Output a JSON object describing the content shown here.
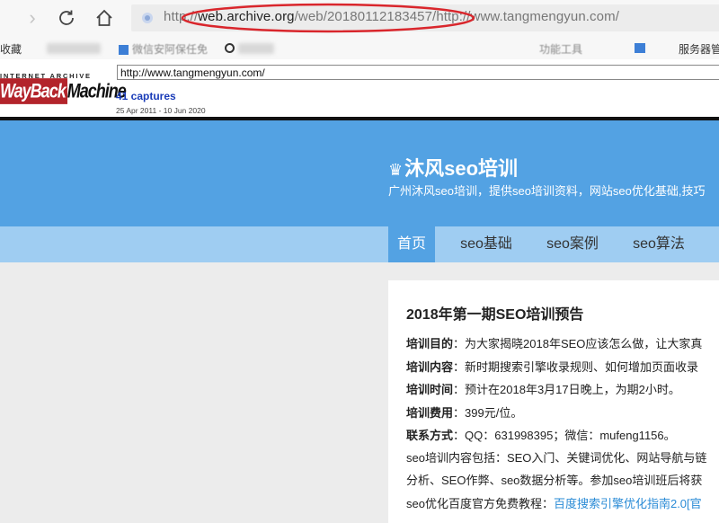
{
  "browser": {
    "url_prefix": "http://",
    "url_domain": "web.archive.org",
    "url_path": "/web/20180112183457/http://www.tangmengyun.com/",
    "icons": [
      "back-arrow-icon",
      "reload-icon",
      "home-icon",
      "site-info-icon"
    ],
    "highlight_color": "#d9262c"
  },
  "bookmarks": {
    "first": "收藏",
    "second": "微信安阿保任免",
    "right_a": "功能工具",
    "right_b": "服务器管"
  },
  "wayback": {
    "ia_text": "INTERNET ARCHIVE",
    "logo_wayback": "WayBack",
    "logo_machine": "Machine",
    "url_value": "http://www.tangmengyun.com/",
    "captures": "41 captures",
    "range": "25 Apr 2011 - 10 Jun 2020",
    "brand_color": "#b3242b"
  },
  "site": {
    "title": "沐风seo培训",
    "subtitle": "广州沐风seo培训，提供seo培训资料，网站seo优化基础,技巧",
    "header_color": "#53a2e3",
    "nav_color": "#9fcdf2",
    "nav": [
      {
        "label": "首页",
        "active": true
      },
      {
        "label": "seo基础",
        "active": false
      },
      {
        "label": "seo案例",
        "active": false
      },
      {
        "label": "seo算法",
        "active": false
      }
    ]
  },
  "post": {
    "title": "2018年第一期SEO培训预告",
    "lines": [
      {
        "key": "培训目的",
        "sep": "：",
        "value": "为大家揭晓2018年SEO应该怎么做，让大家真"
      },
      {
        "key": "培训内容",
        "sep": "：",
        "value": "新时期搜索引擎收录规则、如何增加页面收录"
      },
      {
        "key": "培训时间",
        "sep": "：",
        "value": "预计在2018年3月17日晚上，为期2小时。"
      },
      {
        "key": "培训费用",
        "sep": "：",
        "value": "399元/位。"
      },
      {
        "key": "联系方式",
        "sep": "：",
        "value": "QQ：631998395；微信：mufeng1156。"
      }
    ],
    "para1": "seo培训内容包括：SEO入门、关键词优化、网站导航与链",
    "para2": "分析、SEO作弊、seo数据分析等。参加seo培训班后将获",
    "para3_text": "seo优化百度官方免费教程：",
    "para3_link": "百度搜索引擎优化指南2.0[官"
  }
}
